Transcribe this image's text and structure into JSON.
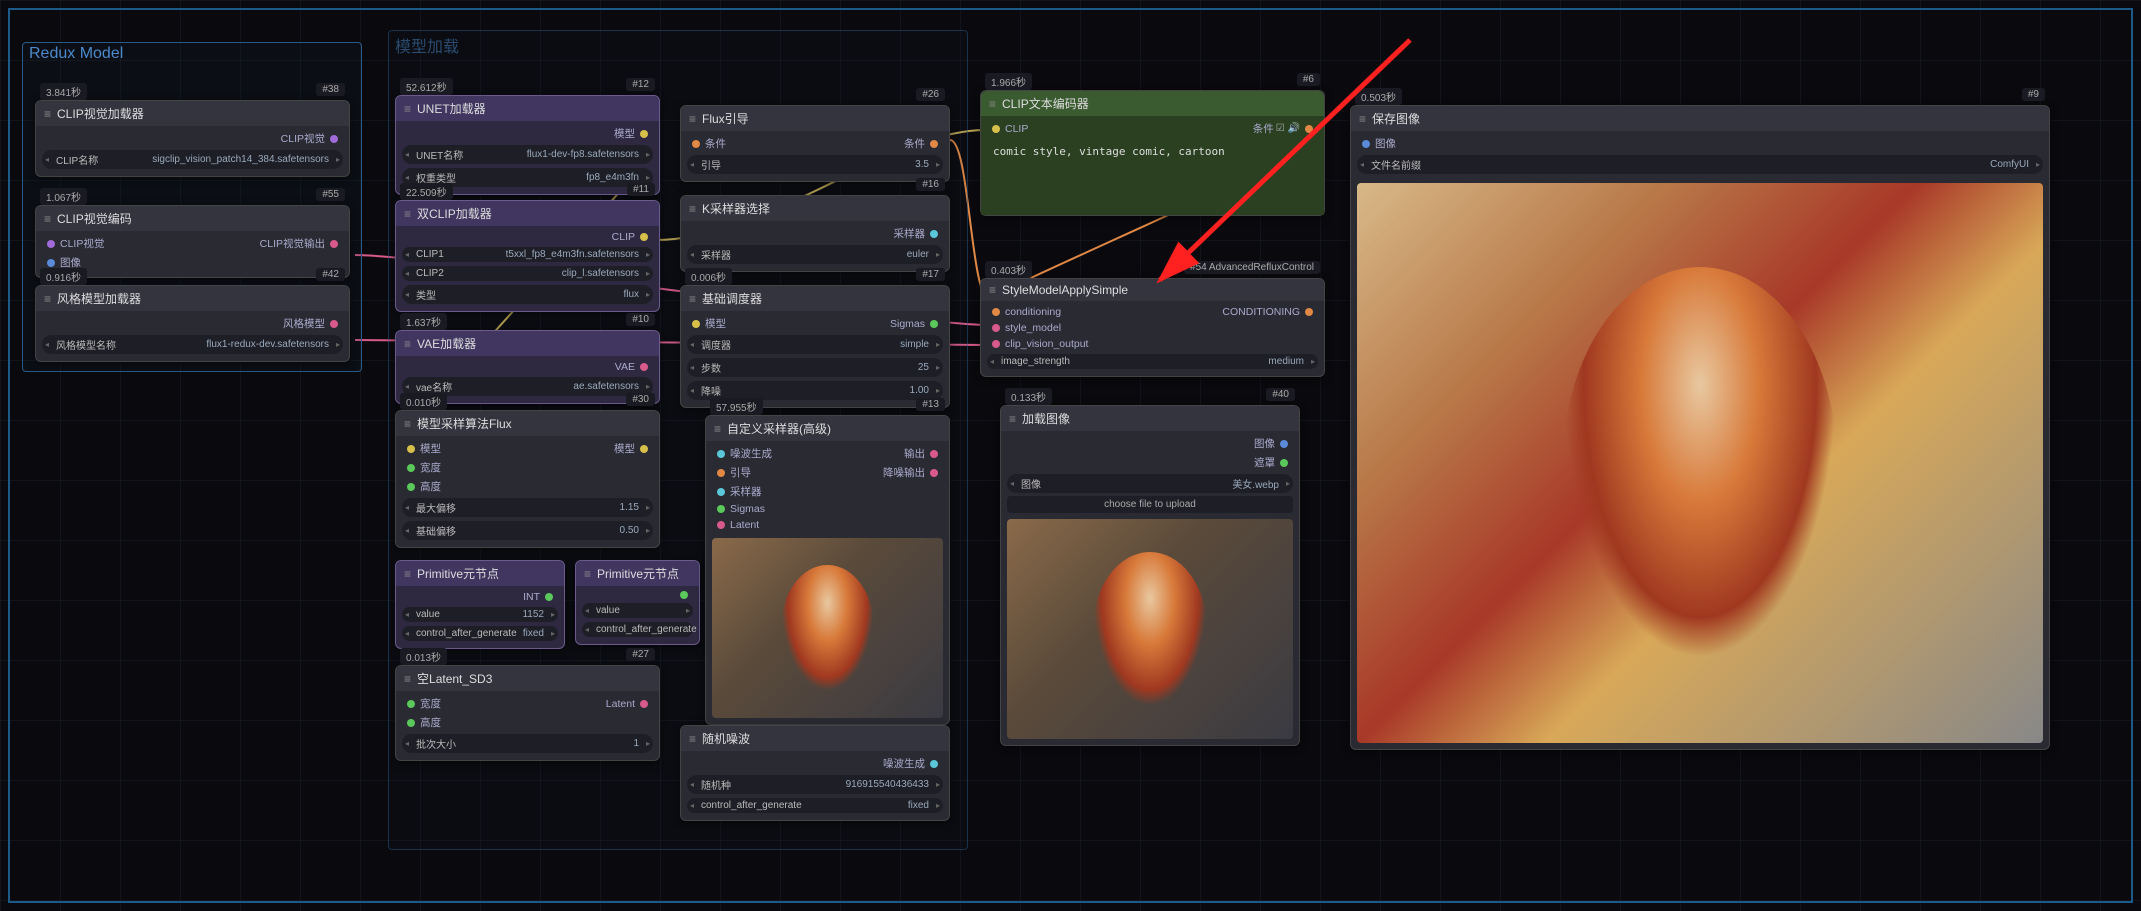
{
  "group": {
    "redux": "Redux Model",
    "model_load": "模型加载"
  },
  "arrow_note": "#54 AdvancedRefluxControl",
  "nodes": {
    "n38": {
      "time": "3.841秒",
      "badge": "#38",
      "title": "CLIP视觉加载器",
      "out": "CLIP视觉",
      "w_label": "CLIP名称",
      "w_val": "sigclip_vision_patch14_384.safetensors"
    },
    "n55": {
      "time": "1.067秒",
      "badge": "#55",
      "title": "CLIP视觉编码",
      "in": "CLIP视觉",
      "in2": "图像",
      "out": "CLIP视觉输出"
    },
    "n42": {
      "time": "0.916秒",
      "badge": "#42",
      "title": "风格模型加载器",
      "out": "风格模型",
      "w_label": "风格模型名称",
      "w_val": "flux1-redux-dev.safetensors"
    },
    "n12": {
      "time": "52.612秒",
      "badge": "#12",
      "title": "UNET加载器",
      "out": "模型",
      "w1l": "UNET名称",
      "w1v": "flux1-dev-fp8.safetensors",
      "w2l": "权重类型",
      "w2v": "fp8_e4m3fn"
    },
    "n11": {
      "time": "22.509秒",
      "badge": "#11",
      "title": "双CLIP加载器",
      "out": "CLIP",
      "w1l": "CLIP1",
      "w1v": "t5xxl_fp8_e4m3fn.safetensors",
      "w2l": "CLIP2",
      "w2v": "clip_l.safetensors",
      "w3l": "类型",
      "w3v": "flux"
    },
    "n10": {
      "time": "1.637秒",
      "badge": "#10",
      "title": "VAE加载器",
      "out": "VAE",
      "w1l": "vae名称",
      "w1v": "ae.safetensors"
    },
    "n30": {
      "time": "0.010秒",
      "badge": "#30",
      "title": "模型采样算法Flux",
      "in1": "模型",
      "in2": "宽度",
      "in3": "高度",
      "out": "模型",
      "w1l": "最大偏移",
      "w1v": "1.15",
      "w2l": "基础偏移",
      "w2v": "0.50"
    },
    "nint": {
      "title": "Primitive元节点",
      "out": "INT",
      "w1l": "value",
      "w1v": "1152",
      "w2l": "control_after_generate",
      "w2v": "fixed"
    },
    "nint2": {
      "title": "Primitive元节点",
      "w1l": "value",
      "w2l": "control_after_generate"
    },
    "n27": {
      "time": "0.013秒",
      "badge": "#27",
      "title": "空Latent_SD3",
      "in1": "宽度",
      "in2": "高度",
      "out": "Latent",
      "w1l": "批次大小",
      "w1v": "1"
    },
    "n26": {
      "badge": "#26",
      "title": "Flux引导",
      "in": "条件",
      "out": "条件",
      "w1l": "引导",
      "w1v": "3.5"
    },
    "n16": {
      "badge": "#16",
      "title": "K采样器选择",
      "out": "采样器",
      "w1l": "采样器"
    },
    "n17": {
      "time": "0.006秒",
      "badge": "#17",
      "title": "基础调度器",
      "in": "模型",
      "out": "Sigmas",
      "w1l": "调度器",
      "w1v": "simple",
      "w2l": "步数",
      "w2v": "25",
      "w3l": "降噪",
      "w3v": "1.00"
    },
    "n13": {
      "time": "57.955秒",
      "badge": "#13",
      "title": "自定义采样器(高级)",
      "in1": "噪波生成",
      "in2": "引导",
      "in3": "采样器",
      "in4": "Sigmas",
      "in5": "Latent",
      "out1": "输出",
      "out2": "降噪输出"
    },
    "n25": {
      "title": "随机噪波",
      "out": "噪波生成",
      "w1l": "随机种",
      "w1v": "916915540436433",
      "w2l": "control_after_generate",
      "w2v": "fixed"
    },
    "n6": {
      "time": "1.966秒",
      "badge": "#6",
      "title": "CLIP文本编码器",
      "in": "CLIP",
      "out": "条件",
      "text": "comic style, vintage comic, cartoon"
    },
    "nSty": {
      "time": "0.403秒",
      "title": "StyleModelApplySimple",
      "in1": "conditioning",
      "in2": "style_model",
      "in3": "clip_vision_output",
      "out": "CONDITIONING",
      "w1l": "image_strength",
      "w1v": "medium"
    },
    "n40": {
      "time": "0.133秒",
      "badge": "#40",
      "title": "加载图像",
      "out1": "图像",
      "out2": "遮罩",
      "w1l": "图像",
      "w1v": "美女.webp",
      "btn": "choose file to upload"
    },
    "n9": {
      "time": "0.503秒",
      "badge": "#9",
      "title": "保存图像",
      "in": "图像",
      "w1l": "文件名前缀",
      "w1v": "ComfyUI"
    },
    "nK": {
      "w1v": "euler"
    }
  }
}
